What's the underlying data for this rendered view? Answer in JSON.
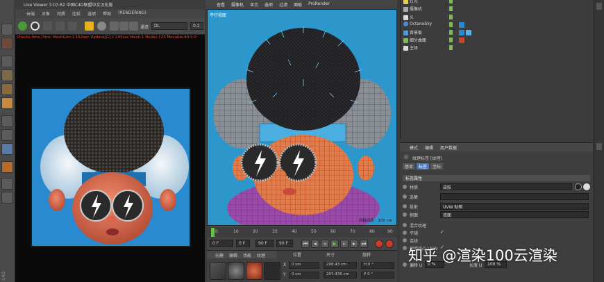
{
  "live_viewer": {
    "title": "Live Viewer 3.07-R2 中国C4D联盟中文汉化版",
    "menu": [
      "云端",
      "对象",
      "材质",
      "比较",
      "选项",
      "帮助",
      "(RENDERING)"
    ],
    "mode_dropdown": "DL",
    "mode_label": "通道",
    "value_field": "0.2",
    "status_line": "Checks:0ms./3ms. MeshGen:1.162sec Update[G]:2.145sec Mesh:1 Nodes:123 Movable:49 0 0"
  },
  "viewport": {
    "menu": [
      "查看",
      "摄像机",
      "显示",
      "选项",
      "过滤",
      "面板",
      "ProRender"
    ],
    "label": "平行视图",
    "grid_label": "网格间距 : 100 cm"
  },
  "timeline": {
    "ticks": [
      "0",
      "10",
      "20",
      "30",
      "40",
      "50",
      "60",
      "70",
      "80",
      "90"
    ],
    "start_field": "0 F",
    "current_field": "0 F",
    "end_field": "90 F",
    "end2_field": "90 F"
  },
  "bottom_panel": {
    "tabs": [
      "创建",
      "编辑",
      "功能",
      "纹理"
    ],
    "coord_headers": [
      "位置",
      "尺寸",
      "旋转"
    ],
    "position": [
      "0 cm",
      "0 cm"
    ],
    "size": [
      "208.43 cm",
      "207.435 cm"
    ],
    "rotation": [
      "H 0 °",
      "P 0 °"
    ],
    "axis_labels": [
      "X",
      "Y"
    ]
  },
  "object_manager": {
    "items": [
      {
        "name": "灯光"
      },
      {
        "name": "摄像机"
      },
      {
        "name": "头"
      },
      {
        "name": "OctaneSky"
      },
      {
        "name": "背景板"
      },
      {
        "name": "细分曲面"
      },
      {
        "name": "主体"
      }
    ]
  },
  "attributes": {
    "tabs": [
      "模式",
      "编辑",
      "用户数据"
    ],
    "object_name": "纹理标签 [纹理]",
    "sub_tabs": [
      "基本",
      "标签",
      "坐标"
    ],
    "section_title": "标签属性",
    "rows": [
      {
        "label": "材质",
        "value": "皮肤"
      },
      {
        "label": "选集",
        "value": ""
      },
      {
        "label": "投射",
        "value": "UVW 贴图"
      },
      {
        "label": "侧面",
        "value": "双面"
      }
    ],
    "checks": [
      {
        "label": "混合纹理",
        "value": ""
      },
      {
        "label": "平铺",
        "value": "✓"
      },
      {
        "label": "连续",
        "value": ""
      },
      {
        "label": "使用凹凸 UVW",
        "value": "✓"
      }
    ],
    "offset_labels": [
      "偏移 U",
      "长度 U"
    ],
    "offset_values": [
      "0 %",
      "100 %"
    ]
  },
  "watermark": "知乎 @渲染100云渲染",
  "colors": {
    "viewport_bg": "#2d97cc",
    "render_bg": "#2a8ad0",
    "accent_red": "#e04a3c",
    "lock_yellow": "#e8b21a"
  }
}
